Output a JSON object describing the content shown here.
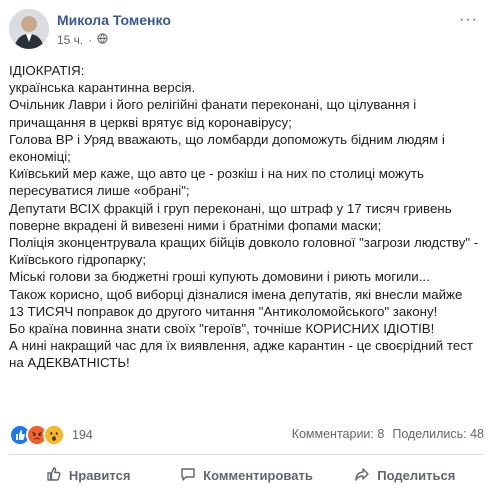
{
  "post": {
    "author": "Микола Томенко",
    "time": "15 ч.",
    "lines": [
      "ІДІОКРАТІЯ:",
      "українська карантинна версія.",
      "Очільник Лаври і його релігійні фанати переконані, що цілування і причащання в церкві врятує від коронавірусу;",
      "Голова ВР і Уряд вважають, що ломбарди допоможуть бідним людям і економіці;",
      "Київський мер каже, що авто це - розкіш і на них по столиці можуть пересуватися лише «обрані\";",
      "Депутати ВСІХ фракцій і груп переконані, що штраф у 17 тисяч гривень поверне вкрадені й вивезені ними і братніми фопами маски;",
      "Поліція зконцентрувала кращих бійців довколо головної \"загрози людству\" - Київського гідропарку;",
      "Міські голови за бюджетні гроші купують домовини і риють могили...",
      "Також корисно, щоб виборці дізналися імена депутатів, які внесли майже 13 ТИСЯЧ поправок до другого читання \"Антиколомойського\" закону!",
      "Бо країна повинна знати своїх \"героїв\", точніше КОРИСНИХ ІДІОТІВ!",
      "А нині накращий час для їх виявлення, адже карантин - це своєрідний тест на АДЕКВАТНІСТЬ!"
    ]
  },
  "stats": {
    "reactions_count": "194",
    "comments": "Комментарии: 8",
    "shares": "Поделились: 48"
  },
  "actions": {
    "like": "Нравится",
    "comment": "Комментировать",
    "share": "Поделиться"
  }
}
